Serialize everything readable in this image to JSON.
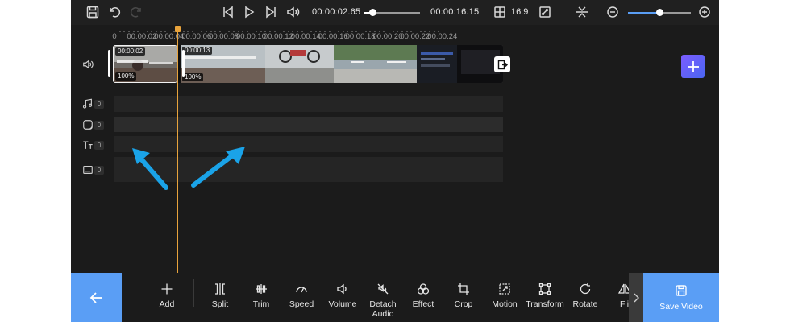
{
  "topbar": {
    "icons": {
      "save": "save-icon",
      "undo": "undo-icon",
      "redo": "redo-icon",
      "skip_back": "skip-back-icon",
      "play": "play-icon",
      "skip_forward": "skip-forward-icon",
      "volume": "volume-icon",
      "aspect": "aspect-ratio-icon",
      "fullscreen": "fullscreen-icon",
      "snap": "snap-icon",
      "zoom_out": "zoom-out-icon",
      "zoom_in": "zoom-in-icon"
    },
    "current_time": "00:00:02.65",
    "total_time": "00:00:16.15",
    "playback_progress": 0.16,
    "aspect_ratio": "16:9",
    "zoom_level": 0.5
  },
  "ruler": {
    "labels": [
      "0",
      "00:00:02",
      "00:00:04",
      "00:00:06",
      "00:00:08",
      "00:00:10",
      "00:00:12",
      "00:00:14",
      "00:00:16",
      "00:00:18",
      "00:00:20",
      "00:00:22",
      "00:00:24"
    ]
  },
  "timeline": {
    "clips": [
      {
        "time": "00:00:02",
        "speed": "100%",
        "selected": true
      },
      {
        "time": "00:00:13",
        "speed": "100%",
        "selected": false
      }
    ],
    "tracks": [
      {
        "type": "music",
        "icon": "music-note-icon",
        "count": "0"
      },
      {
        "type": "sticker",
        "icon": "sticker-icon",
        "count": "0"
      },
      {
        "type": "text",
        "icon": "text-icon",
        "count": "0"
      },
      {
        "type": "subtitle",
        "icon": "subtitle-icon",
        "count": "0"
      }
    ],
    "video_track_icon": "speaker-icon"
  },
  "colors": {
    "accent": "#5a9ef5",
    "playhead": "#e8a33c",
    "pointer_arrow": "#1aa3e8",
    "add_button_gradient": [
      "#7b5cff",
      "#4a66f2"
    ]
  },
  "tools": [
    {
      "id": "add",
      "label": "Add",
      "icon": "plus-icon"
    },
    {
      "id": "split",
      "label": "Split",
      "icon": "split-icon"
    },
    {
      "id": "trim",
      "label": "Trim",
      "icon": "trim-icon"
    },
    {
      "id": "speed",
      "label": "Speed",
      "icon": "speedometer-icon"
    },
    {
      "id": "volume",
      "label": "Volume",
      "icon": "volume-icon"
    },
    {
      "id": "detach",
      "label": "Detach Audio",
      "icon": "detach-audio-icon"
    },
    {
      "id": "effect",
      "label": "Effect",
      "icon": "effect-icon"
    },
    {
      "id": "crop",
      "label": "Crop",
      "icon": "crop-icon"
    },
    {
      "id": "motion",
      "label": "Motion",
      "icon": "motion-icon"
    },
    {
      "id": "transform",
      "label": "Transform",
      "icon": "transform-icon"
    },
    {
      "id": "rotate",
      "label": "Rotate",
      "icon": "rotate-icon"
    },
    {
      "id": "flip",
      "label": "Flip",
      "icon": "flip-icon"
    }
  ],
  "save_button": {
    "label": "Save Video",
    "icon": "save-icon"
  },
  "back_button": {
    "icon": "arrow-left-icon"
  }
}
